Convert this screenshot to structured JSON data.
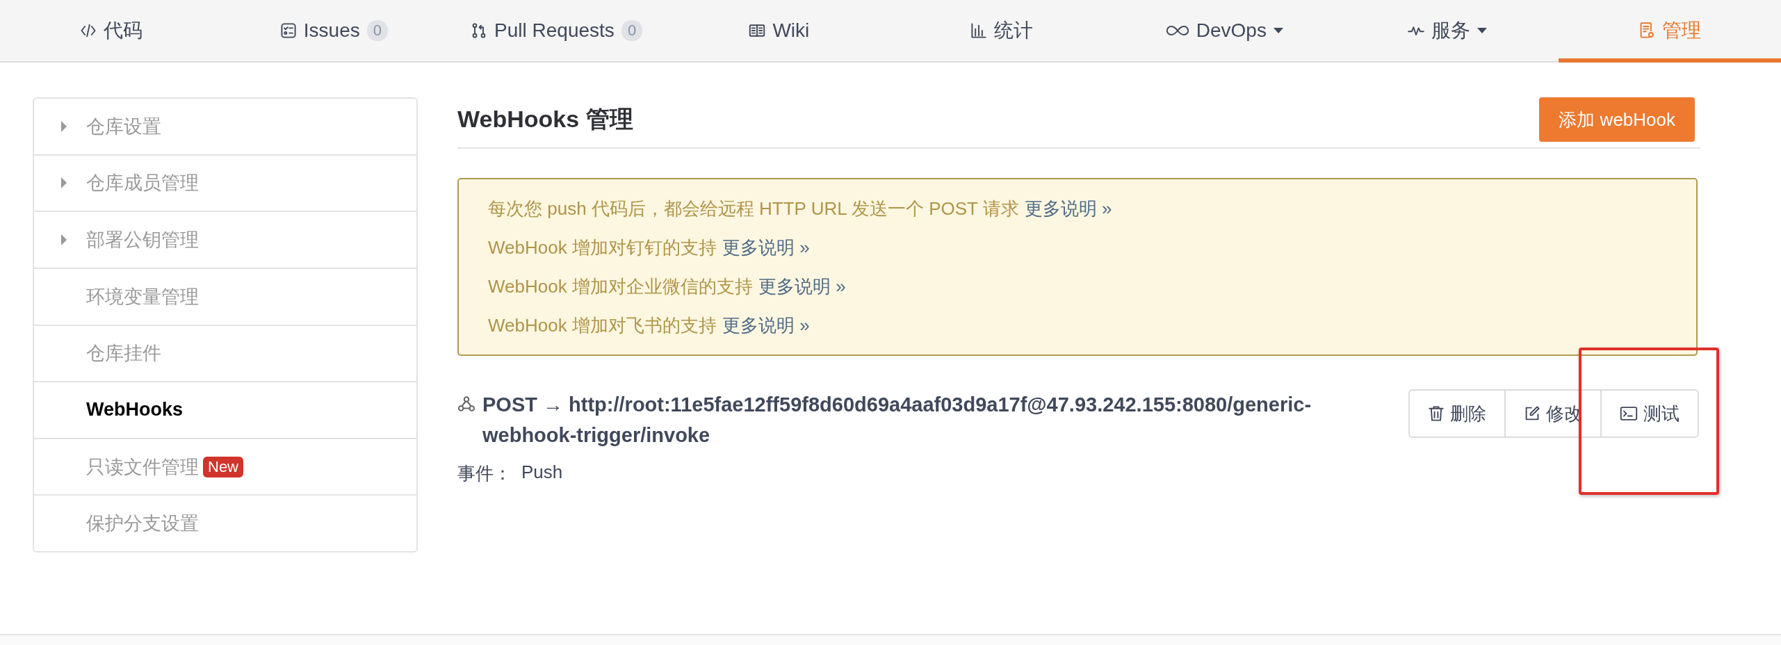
{
  "tabs": [
    {
      "label": "代码",
      "selected": false
    },
    {
      "label": "Issues",
      "count": "0",
      "selected": false
    },
    {
      "label": "Pull Requests",
      "count": "0",
      "selected": false
    },
    {
      "label": "Wiki",
      "selected": false
    },
    {
      "label": "统计",
      "selected": false
    },
    {
      "label": "DevOps",
      "dropdown": true,
      "selected": false
    },
    {
      "label": "服务",
      "dropdown": true,
      "selected": false
    },
    {
      "label": "管理",
      "selected": true
    }
  ],
  "sidebar": {
    "items": [
      {
        "label": "仓库设置",
        "expandable": true,
        "selected": false
      },
      {
        "label": "仓库成员管理",
        "expandable": true,
        "selected": false
      },
      {
        "label": "部署公钥管理",
        "expandable": true,
        "selected": false
      },
      {
        "label": "环境变量管理",
        "expandable": false,
        "selected": false
      },
      {
        "label": "仓库挂件",
        "expandable": false,
        "selected": false
      },
      {
        "label": "WebHooks",
        "expandable": false,
        "selected": true
      },
      {
        "label": "只读文件管理",
        "expandable": false,
        "badge": "New",
        "selected": false
      },
      {
        "label": "保护分支设置",
        "expandable": false,
        "selected": false
      }
    ]
  },
  "page": {
    "title": "WebHooks 管理",
    "add_button": "添加 webHook"
  },
  "notice": {
    "lines": [
      {
        "text": "每次您 push 代码后，都会给远程 HTTP URL 发送一个 POST 请求",
        "link": "更多说明 »"
      },
      {
        "text": "WebHook 增加对钉钉的支持",
        "link": "更多说明 »"
      },
      {
        "text": "WebHook 增加对企业微信的支持",
        "link": "更多说明 »"
      },
      {
        "text": "WebHook 增加对飞书的支持",
        "link": "更多说明 »"
      }
    ]
  },
  "webhooks": [
    {
      "title": "POST → http://root:11e5fae12ff59f8d60d69a4aaf03d9a17f@47.93.242.155:8080/generic-webhook-trigger/invoke",
      "event_label": "事件：",
      "event": "Push",
      "actions": [
        {
          "kind": "delete",
          "label": "删除"
        },
        {
          "kind": "edit",
          "label": "修改"
        },
        {
          "kind": "test",
          "label": "测试"
        }
      ]
    }
  ],
  "annotations": [
    {
      "kind": "rectangle"
    }
  ]
}
